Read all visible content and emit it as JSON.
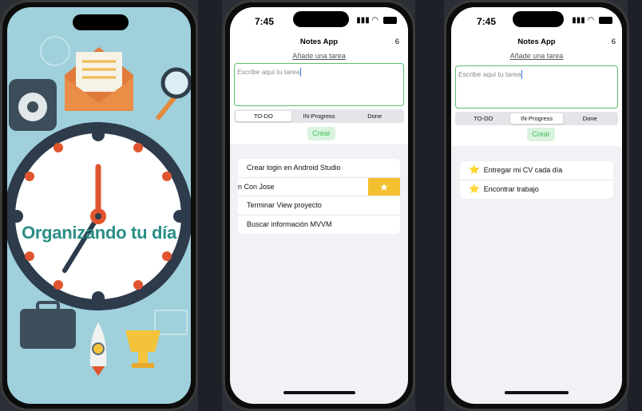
{
  "splash": {
    "title": "Organizando tu día",
    "colors": {
      "background": "#9fd0dc",
      "title": "#2a8e86"
    }
  },
  "status": {
    "time": "7:45"
  },
  "app": {
    "title": "Notes App",
    "add_link": "Añade una tarea",
    "input_placeholder": "Escribe aquí tu tarea",
    "create_button": "Crear",
    "segments": [
      "TO-DO",
      "IN-Progress",
      "Done"
    ],
    "accent": "#5cc16a",
    "star_color": "#f3c12f"
  },
  "screen_todo": {
    "count": "6",
    "selected_segment": "TO-DO",
    "tasks": [
      "Crear login en Android Studio",
      "n Con Jose",
      "Terminar View proyecto",
      "Buscar información MVVM"
    ],
    "swipe_action": "★"
  },
  "screen_progress": {
    "count": "6",
    "selected_segment": "IN-Progress",
    "tasks": [
      "Entregar mi CV cada día",
      "Encontrar trabajo"
    ],
    "fav_star": "⭐"
  }
}
